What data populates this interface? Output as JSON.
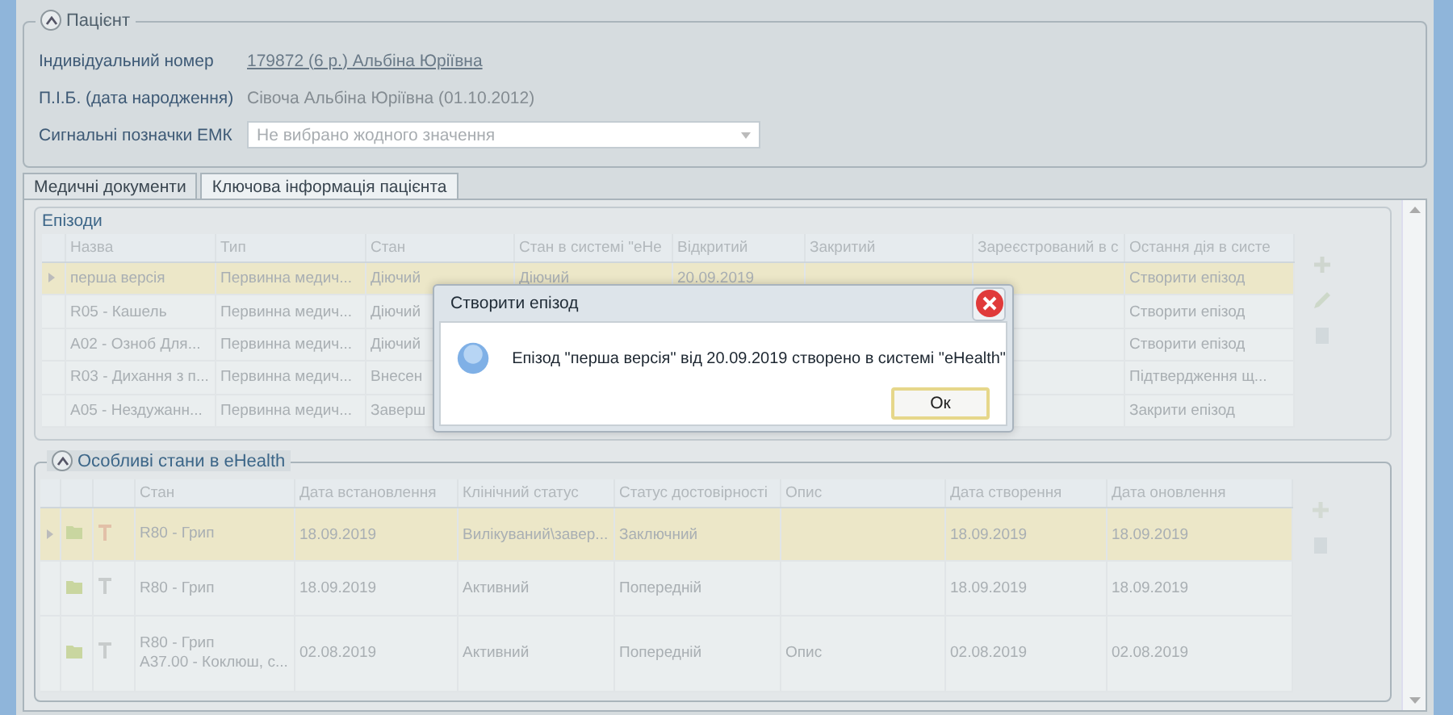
{
  "patient": {
    "title": "Пацієнт",
    "expanded": true,
    "fields": [
      {
        "kind": "link",
        "label": "Індивідуальний номер",
        "value": "179872 (6 р.) Альбіна Юріївна"
      },
      {
        "kind": "text",
        "label": "П.І.Б. (дата народження)",
        "value": "Сівоча Альбіна Юріївна (01.10.2012)"
      },
      {
        "kind": "select",
        "label": "Сигнальні позначки ЕМК",
        "placeholder": "Не вибрано жодного значення"
      }
    ]
  },
  "tabs": [
    {
      "label": "Медичні документи",
      "selected": false
    },
    {
      "label": "Ключова інформація пацієнта",
      "selected": true
    }
  ],
  "episodes": {
    "title": "Епізоди",
    "columns": [
      "Назва",
      "Тип",
      "Стан",
      "Стан в системі \"eHe",
      "Відкритий",
      "Закритий",
      "Зареєстрований в с",
      "Остання дія в систе"
    ],
    "rows": [
      {
        "selected": true,
        "name": "перша версія",
        "type": "Первинна медич...",
        "state": "Діючий",
        "state_ehealth": "Діючий",
        "opened": "20.09.2019",
        "last_action": "Створити епізод"
      },
      {
        "selected": false,
        "name": "R05 - Кашель",
        "type": "Первинна медич...",
        "state": "Діючий",
        "last_action": "Створити епізод"
      },
      {
        "selected": false,
        "name": "A02 - Озноб Для...",
        "type": "Первинна медич...",
        "state": "Діючий",
        "last_action": "Створити епізод"
      },
      {
        "selected": false,
        "name": "R03 - Дихання з п...",
        "type": "Первинна медич...",
        "state": "Внесен",
        "last_action": "Підтвердження щ..."
      },
      {
        "selected": false,
        "name": "A05 - Нездужанн...",
        "type": "Первинна медич...",
        "state": "Заверш",
        "last_action": "Закрити епізод"
      }
    ]
  },
  "conditions": {
    "title": "Особливі стани в eHealth",
    "expanded": true,
    "columns": [
      "Стан",
      "Дата встановлення",
      "Клінічний статус",
      "Статус достовірності",
      "Опис",
      "Дата створення",
      "Дата оновлення"
    ],
    "rows": [
      {
        "selected": true,
        "state": [
          "R80 - Грип"
        ],
        "date_set": "18.09.2019",
        "clinical_status": "Вилікуваний\\завер...",
        "verification_status": "Заключний",
        "created": "18.09.2019",
        "updated": "18.09.2019"
      },
      {
        "selected": false,
        "state": [
          "R80 - Грип"
        ],
        "date_set": "18.09.2019",
        "clinical_status": "Активний",
        "verification_status": "Попередній",
        "created": "18.09.2019",
        "updated": "18.09.2019"
      },
      {
        "selected": false,
        "state": [
          "R80 - Грип",
          "A37.00 - Коклюш, с..."
        ],
        "date_set": "02.08.2019",
        "clinical_status": "Активний",
        "verification_status": "Попередній",
        "description": "Опис",
        "created": "02.08.2019",
        "updated": "02.08.2019"
      }
    ]
  },
  "dialog": {
    "title": "Створити епізод",
    "message": "Епізод \"перша версія\" від 20.09.2019 створено в системі \"eHealth\"",
    "button": "Ок"
  }
}
